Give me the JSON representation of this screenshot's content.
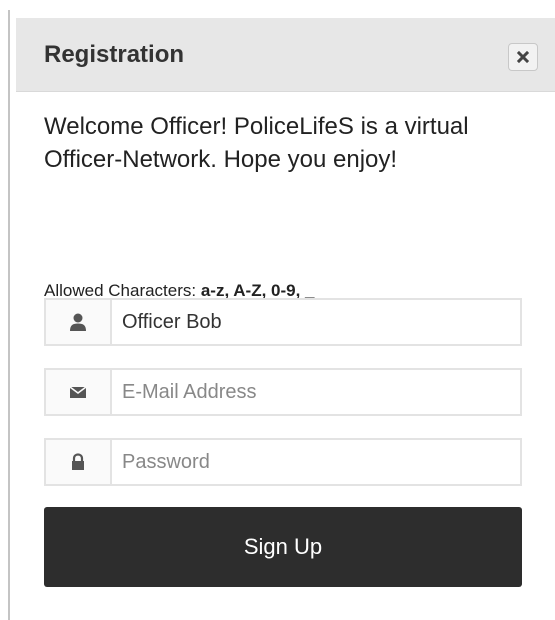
{
  "dialog": {
    "title": "Registration",
    "close_icon": "close-icon"
  },
  "welcome_text": "Welcome Officer! PoliceLifeS is a virtual Officer-Network. Hope you enjoy!",
  "allowed": {
    "prefix": "Allowed Characters: ",
    "chars": "a-z, A-Z, 0-9, _"
  },
  "fields": {
    "username": {
      "icon": "user-icon",
      "value": "Officer Bob",
      "placeholder": ""
    },
    "email": {
      "icon": "envelope-icon",
      "value": "",
      "placeholder": "E-Mail Address"
    },
    "password": {
      "icon": "lock-icon",
      "value": "",
      "placeholder": "Password"
    }
  },
  "signup_label": "Sign Up",
  "colors": {
    "header_bg": "#e7e7e7",
    "button_bg": "#2d2d2d",
    "button_text": "#ffffff"
  }
}
